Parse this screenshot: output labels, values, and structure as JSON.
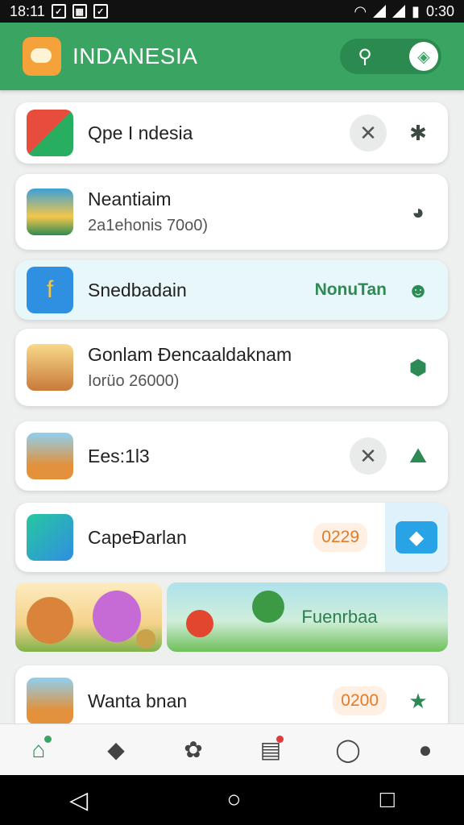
{
  "status": {
    "time": "18:11",
    "clock": "0:30"
  },
  "app": {
    "title": "INDANESIA"
  },
  "items": [
    {
      "name": "Qpe I ndesia",
      "sub": "",
      "tag": ""
    },
    {
      "name": "Neantiaim",
      "sub": "2a1ehonis 70o0)",
      "tag": ""
    },
    {
      "name": "Snedbadain",
      "sub": "",
      "tag": "NonuTan"
    },
    {
      "name": "Gonlam Đencaaldaknam",
      "sub": "Iorüo 26000)",
      "tag": ""
    },
    {
      "name": "Ees:1l3",
      "sub": "",
      "tag": ""
    },
    {
      "name": "CapeĐarlan",
      "sub": "",
      "tag": "0229"
    },
    {
      "name": "Wanta bnan",
      "sub": "",
      "tag": "0200"
    }
  ],
  "banner": {
    "text": "Fuenrbaa"
  },
  "colors": {
    "primary": "#3aa563",
    "accent": "#e07b2a",
    "blue": "#28a3e6"
  }
}
